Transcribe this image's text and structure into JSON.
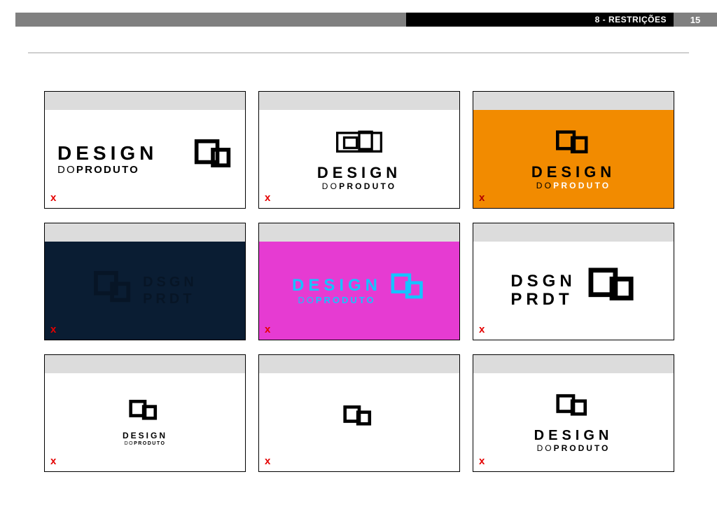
{
  "header": {
    "section_number": "8",
    "section_title": "RESTRIÇÕES",
    "page_number": "15"
  },
  "brand": {
    "line1": "DESIGN",
    "line2_prefix": "DO",
    "line2_suffix": "PRODUTO"
  },
  "alt_brand": {
    "line1": "DSGN",
    "line2": "PRDT"
  },
  "reject_mark": "x",
  "cards": [
    {
      "id": 1,
      "bg": "#ffffff"
    },
    {
      "id": 2,
      "bg": "#ffffff"
    },
    {
      "id": 3,
      "bg": "#f28b00"
    },
    {
      "id": 4,
      "bg": "#0a1d33"
    },
    {
      "id": 5,
      "bg": "#e63bd2"
    },
    {
      "id": 6,
      "bg": "#ffffff"
    },
    {
      "id": 7,
      "bg": "#ffffff"
    },
    {
      "id": 8,
      "bg": "#ffffff"
    },
    {
      "id": 9,
      "bg": "#ffffff"
    }
  ]
}
